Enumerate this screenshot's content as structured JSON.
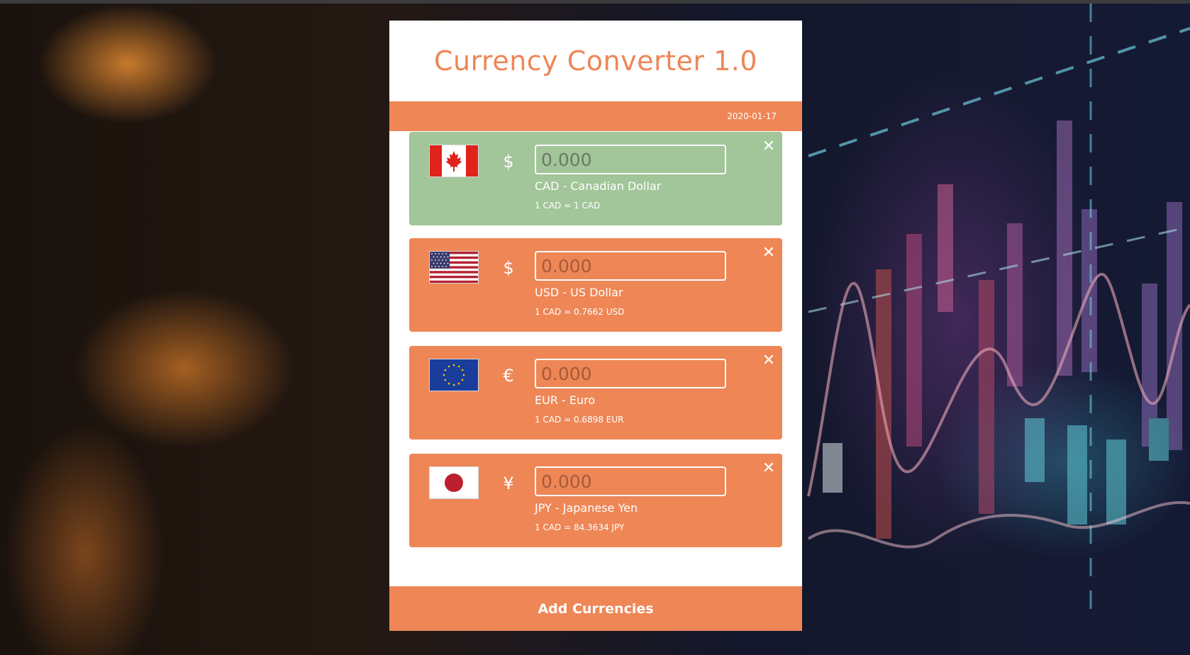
{
  "app": {
    "title": "Currency Converter 1.0",
    "date": "2020-01-17",
    "add_button_label": "Add Currencies",
    "accent_color": "#ee8656",
    "base_color": "#a2c599"
  },
  "currencies": [
    {
      "code": "CAD",
      "flag_icon": "canada-flag-icon",
      "symbol": "$",
      "placeholder": "0.000",
      "name": "CAD - Canadian Dollar",
      "rate": "1 CAD = 1 CAD",
      "close_glyph": "✕"
    },
    {
      "code": "USD",
      "flag_icon": "usa-flag-icon",
      "symbol": "$",
      "placeholder": "0.000",
      "name": "USD - US Dollar",
      "rate": "1 CAD = 0.7662 USD",
      "close_glyph": "✕"
    },
    {
      "code": "EUR",
      "flag_icon": "eu-flag-icon",
      "symbol": "€",
      "placeholder": "0.000",
      "name": "EUR - Euro",
      "rate": "1 CAD = 0.6898 EUR",
      "close_glyph": "✕"
    },
    {
      "code": "JPY",
      "flag_icon": "japan-flag-icon",
      "symbol": "¥",
      "placeholder": "0.000",
      "name": "JPY - Japanese Yen",
      "rate": "1 CAD = 84.3634 JPY",
      "close_glyph": "✕"
    }
  ]
}
